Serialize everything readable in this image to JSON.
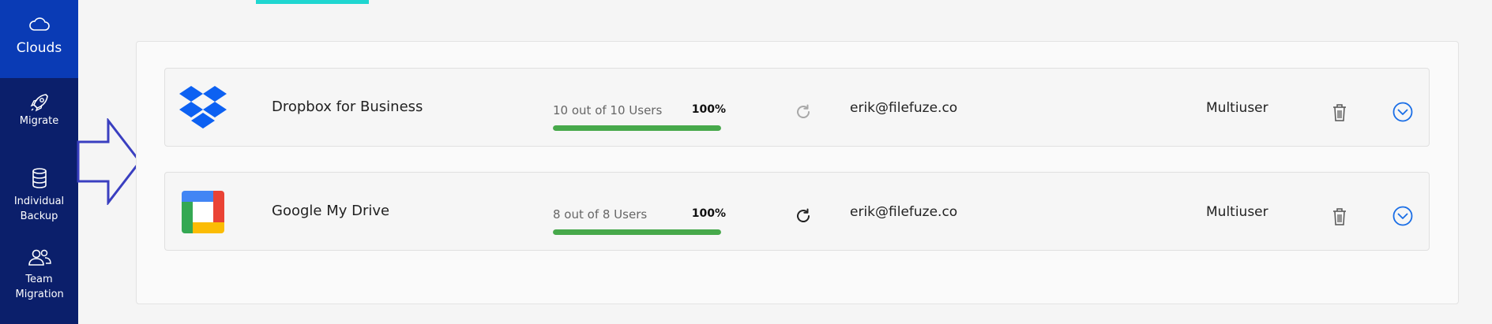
{
  "sidebar": {
    "items": [
      {
        "label": "Clouds",
        "icon": "cloud-icon",
        "active": true
      },
      {
        "label": "Migrate",
        "icon": "rocket-icon"
      },
      {
        "label": "Individual Backup",
        "icon": "database-icon"
      },
      {
        "label": "Team Migration",
        "icon": "users-icon"
      }
    ]
  },
  "colors": {
    "sidebar_bg": "#0b1f6b",
    "active_bg": "#0a3bb5",
    "accent": "#1fd6d0",
    "progress": "#47a94b",
    "arrow": "#3a3fc0",
    "expand": "#1a6ee6"
  },
  "clouds": [
    {
      "name": "Dropbox for Business",
      "logo": "dropbox-logo",
      "users_text": "10 out of 10 Users",
      "percent_label": "100%",
      "progress_fraction": 1.0,
      "email": "erik@filefuze.co",
      "type": "Multiuser",
      "refresh_state": "disabled"
    },
    {
      "name": "Google My Drive",
      "logo": "google-drive-logo",
      "users_text": "8 out of 8 Users",
      "percent_label": "100%",
      "progress_fraction": 1.0,
      "email": "erik@filefuze.co",
      "type": "Multiuser",
      "refresh_state": "enabled"
    }
  ]
}
